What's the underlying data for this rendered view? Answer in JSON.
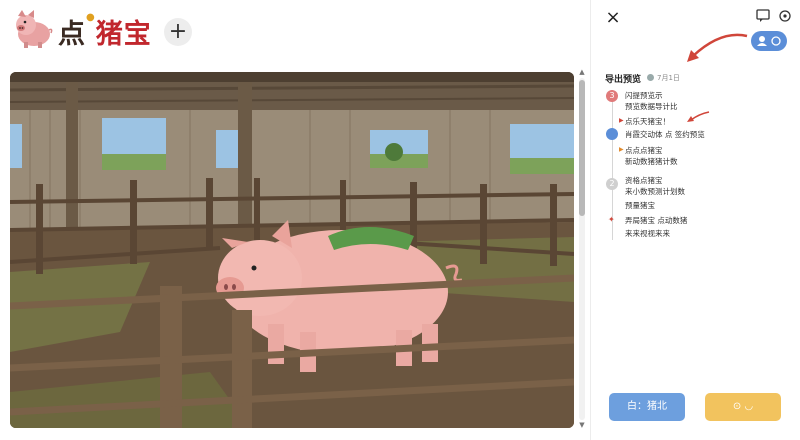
{
  "brand": {
    "title_part1": "点",
    "title_part2": "猪宝",
    "add_label": "+"
  },
  "panel": {
    "close_label": "×",
    "title": "导出预览",
    "subtitle": "7月1日",
    "steps": [
      {
        "num": "3",
        "lines": [
          "闪提预览示",
          "预览数据导计比"
        ],
        "color": "#e07a7a"
      },
      {
        "num": "",
        "lines": [
          "点乐天猪宝！"
        ],
        "color": ""
      },
      {
        "num": "",
        "lines": [
          "肖霞交动体 点 签约预览"
        ],
        "color": "#5b8ed8"
      },
      {
        "num": "",
        "lines": [
          "点点点猪宝",
          "新动数猪猪计数"
        ],
        "color": ""
      },
      {
        "num": "2",
        "lines": [
          "资格点猪宝",
          "来小数预测计划数"
        ],
        "color": "#cfcfcf"
      },
      {
        "num": "",
        "lines": [
          "预量猪宝"
        ],
        "color": ""
      },
      {
        "num": "",
        "lines": [
          "弄局猪宝 点动数猪",
          "来来视视来来"
        ],
        "color": "#e07a7a"
      }
    ],
    "primary_button": "白：猪北",
    "secondary_button": "⊙ ◡"
  },
  "colors": {
    "primary": "#6d9fde",
    "secondary": "#f2c35e",
    "accent": "#c1272d",
    "annotation": "#d0463a"
  },
  "icons": {
    "logo": "pig-mascot-icon",
    "close": "close-icon",
    "chat": "chat-icon",
    "settings": "settings-icon",
    "user": "user-icon"
  }
}
